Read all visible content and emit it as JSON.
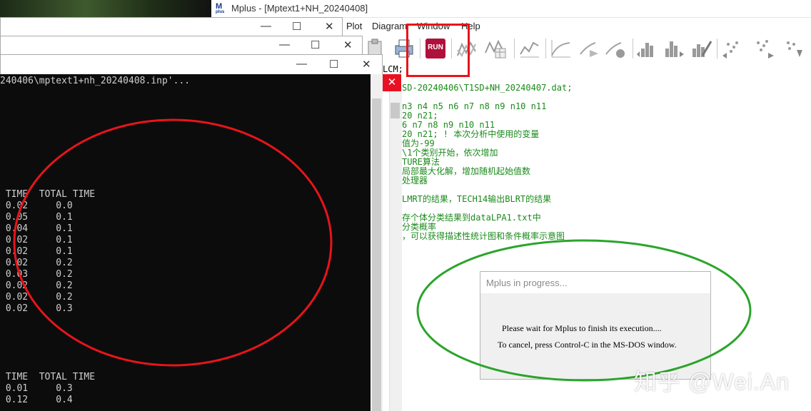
{
  "mplus_window": {
    "title": "Mplus - [Mptext1+NH_20240408]",
    "logo": "M",
    "logo_sub": "plus"
  },
  "menu": {
    "plot": "Plot",
    "diagram": "Diagram",
    "window": "Window",
    "help": "Help"
  },
  "toolbar": {
    "run_label": "RUN"
  },
  "editor": {
    "lcm": "LCM;",
    "lines": [
      "SD-20240406\\T1SD+NH_20240407.dat;",
      "",
      "n3 n4 n5 n6 n7 n8 n9 n10 n11",
      "20 n21;",
      "6 n7 n8 n9 n10 n11",
      "20 n21; ! 本次分析中使用的变量",
      "值为-99",
      "\\1个类别开始，依次增加",
      "TURE算法",
      "局部最大化解，增加随机起始值数",
      "处理器",
      "",
      "LMRT的结果，TECH14输出BLRT的结果",
      "",
      "存个体分类结果到dataLPA1.txt中",
      "分类概率",
      "，可以获得描述性统计图和条件概率示意图"
    ]
  },
  "console": {
    "path_line": "240406\\mptext1+nh_20240408.inp'...",
    "table1_header": " TIME  TOTAL TIME",
    "table1_rows": [
      " 0.02     0.0",
      " 0.05     0.1",
      " 0.04     0.1",
      " 0.02     0.1",
      " 0.02     0.1",
      " 0.02     0.2",
      " 0.03     0.2",
      " 0.02     0.2",
      " 0.02     0.2",
      " 0.02     0.3"
    ],
    "table2_header": " TIME  TOTAL TIME",
    "table2_rows": [
      " 0.01     0.3",
      " 0.12     0.4"
    ]
  },
  "window_controls": {
    "minimize": "—",
    "maximize": "☐",
    "close": "✕"
  },
  "dialog": {
    "title": "Mplus in progress...",
    "line1": "Please wait for Mplus to finish its execution....",
    "line2": "To cancel, press Control-C in the MS-DOS window."
  },
  "watermark": "知乎 @Wei.An",
  "colors": {
    "annotation_red": "#e8141b",
    "annotation_green": "#2aa52a",
    "run_button": "#b0113c",
    "editor_text": "#1b8a1b"
  }
}
